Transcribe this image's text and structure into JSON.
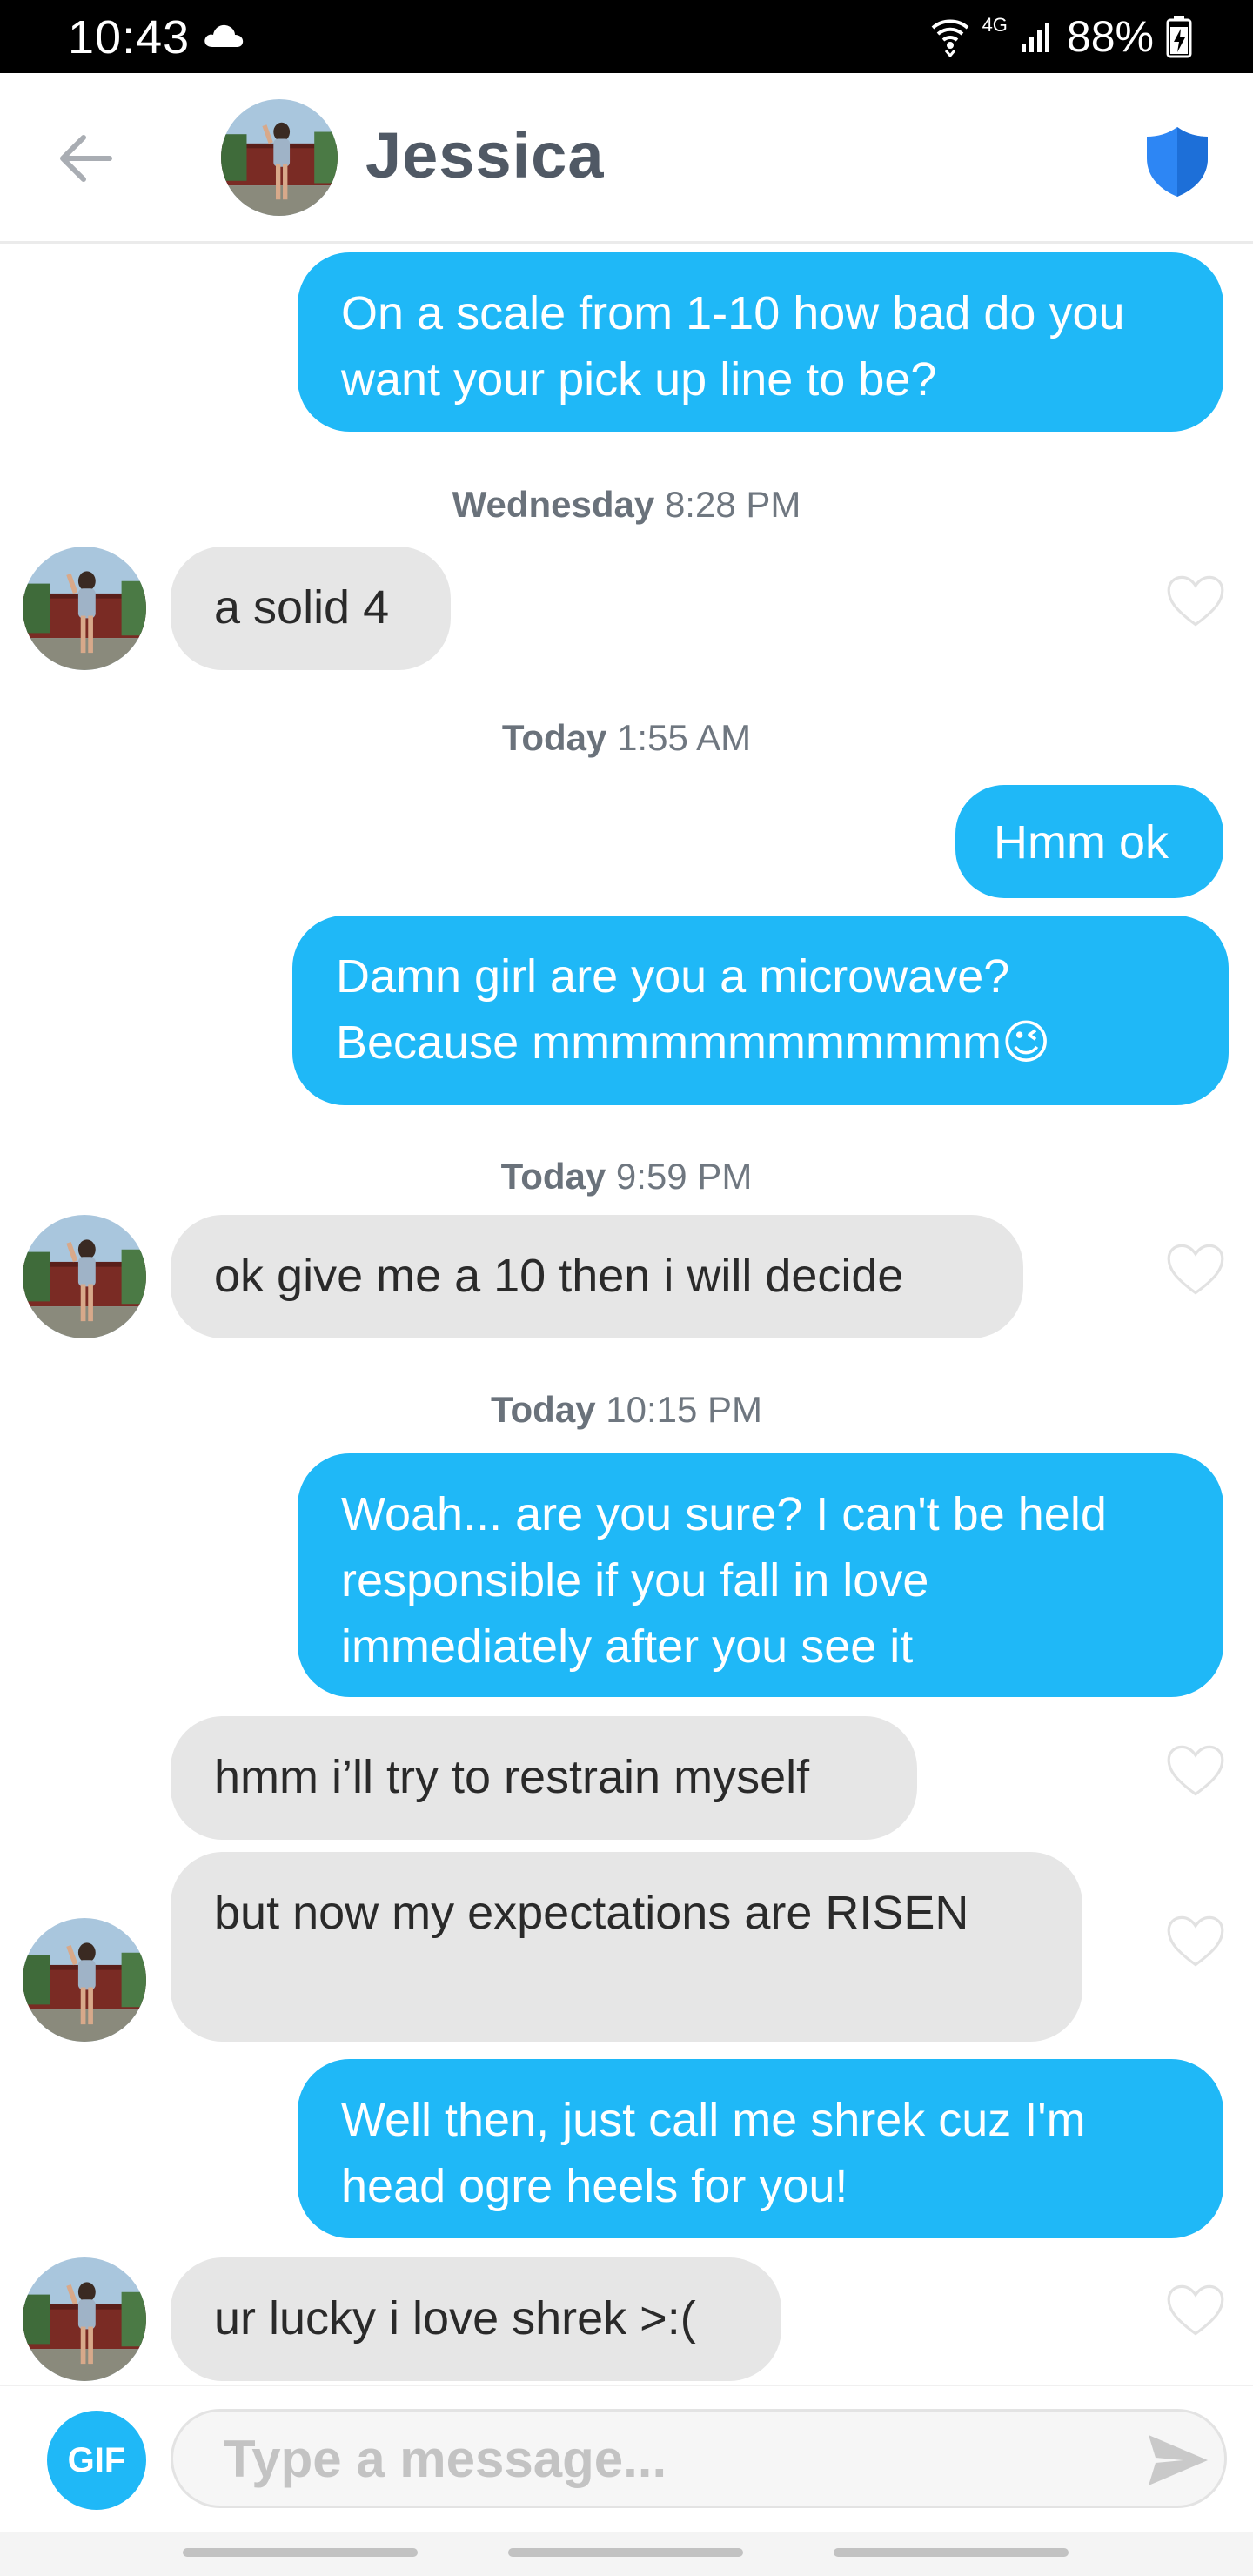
{
  "status_bar": {
    "time": "10:43",
    "network": "4G",
    "battery": "88%",
    "icons": [
      "cloud-icon",
      "wifi-icon",
      "signal-icon",
      "battery-charging-icon"
    ]
  },
  "header": {
    "contact_name": "Jessica",
    "icons": [
      "back-arrow-icon",
      "shield-icon"
    ]
  },
  "colors": {
    "sent_bubble": "#1fb8f7",
    "received_bubble": "#e6e6e6",
    "shield": "#2d86f4"
  },
  "messages": [
    {
      "type": "sent",
      "text": "On a scale from 1-10 how bad do you want your pick up line to be?"
    },
    {
      "type": "stamp",
      "day": "Wednesday",
      "time": "8:28 PM"
    },
    {
      "type": "received",
      "text": "a solid 4"
    },
    {
      "type": "stamp",
      "day": "Today",
      "time": "1:55 AM"
    },
    {
      "type": "sent",
      "text": "Hmm ok"
    },
    {
      "type": "sent",
      "text": "Damn girl are you a microwave? Because mmmmmmmmmmmm😉"
    },
    {
      "type": "stamp",
      "day": "Today",
      "time": "9:59 PM"
    },
    {
      "type": "received",
      "text": "ok give me a 10 then i will decide"
    },
    {
      "type": "stamp",
      "day": "Today",
      "time": "10:15 PM"
    },
    {
      "type": "sent",
      "text": "Woah... are you sure? I can't be held responsible if you fall in love immediately after you see it"
    },
    {
      "type": "received",
      "text": "hmm i’ll try to restrain myself"
    },
    {
      "type": "received",
      "text": "but now my expectations are RISEN"
    },
    {
      "type": "sent",
      "text": "Well then, just call me shrek cuz I'm head ogre heels for you!"
    },
    {
      "type": "received",
      "text": "ur lucky i love shrek >:("
    }
  ],
  "composer": {
    "gif_label": "GIF",
    "placeholder": "Type a message..."
  }
}
